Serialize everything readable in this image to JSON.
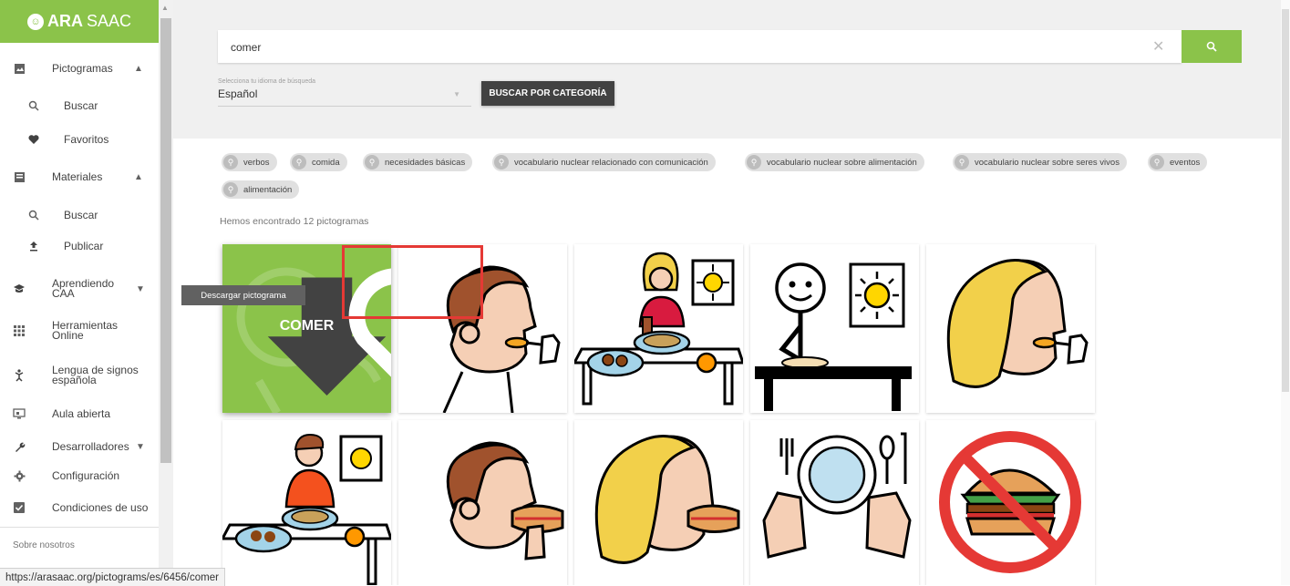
{
  "logo": {
    "part1": "ARA",
    "part2": "SAAC"
  },
  "sidebar": {
    "items": [
      {
        "label": "Pictogramas",
        "icon": "image-icon",
        "chevron": "up"
      },
      {
        "label": "Buscar",
        "icon": "search-icon"
      },
      {
        "label": "Favoritos",
        "icon": "heart-icon"
      },
      {
        "label": "Materiales",
        "icon": "book-icon",
        "chevron": "up"
      },
      {
        "label": "Buscar",
        "icon": "search-icon"
      },
      {
        "label": "Publicar",
        "icon": "upload-icon"
      },
      {
        "label": "Aprendiendo CAA",
        "icon": "school-icon",
        "chevron": "down"
      },
      {
        "label": "Herramientas Online",
        "icon": "apps-icon"
      },
      {
        "label": "Lengua de signos española",
        "icon": "sign-language-icon"
      },
      {
        "label": "Aula abierta",
        "icon": "classroom-icon"
      },
      {
        "label": "Desarrolladores",
        "icon": "wrench-icon",
        "chevron": "down"
      },
      {
        "label": "Configuración",
        "icon": "gear-icon"
      },
      {
        "label": "Condiciones de uso",
        "icon": "checkbox-icon"
      }
    ],
    "footer": "Sobre nosotros"
  },
  "search": {
    "query": "comer",
    "lang_label": "Selecciona tu idioma de búsqueda",
    "lang_value": "Español",
    "category_button": "BUSCAR POR CATEGORÍA"
  },
  "chips": [
    "verbos",
    "comida",
    "necesidades básicas",
    "vocabulario nuclear relacionado con comunicación",
    "vocabulario nuclear sobre alimentación",
    "vocabulario nuclear sobre seres vivos",
    "eventos",
    "alimentación"
  ],
  "result_count": "Hemos encontrado 12 pictogramas",
  "active_card": {
    "title": "COMER"
  },
  "tooltip": "Descargar pictograma",
  "status_url": "https://arasaac.org/pictograms/es/6456/comer",
  "colors": {
    "brand": "#8bc34a",
    "dark_button": "#424242",
    "highlight": "#e53935"
  }
}
